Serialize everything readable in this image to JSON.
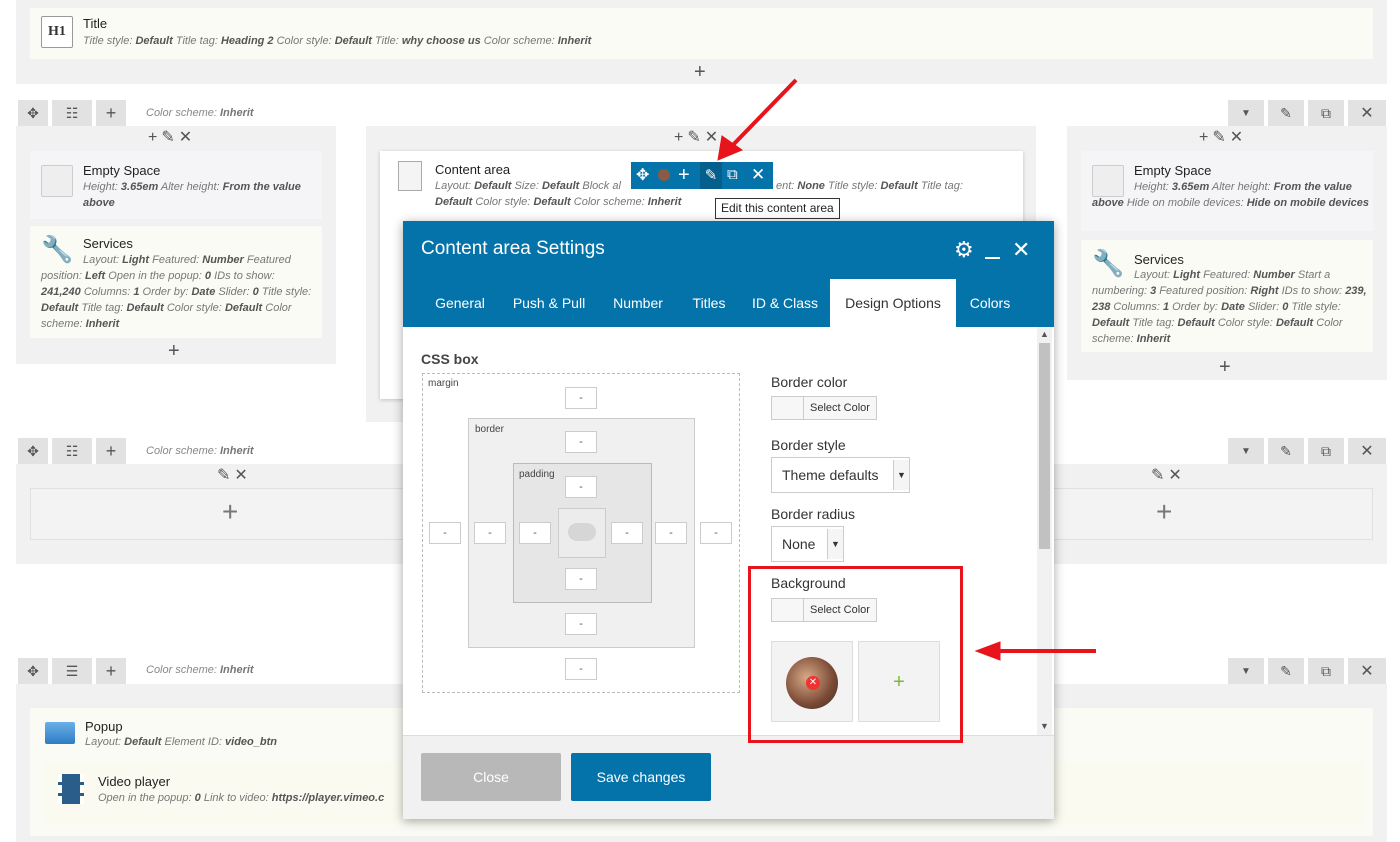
{
  "title_block": {
    "icon_text": "H1",
    "label": "Title",
    "meta": [
      {
        "k": "Title style:",
        "v": "Default"
      },
      {
        "k": "Title tag:",
        "v": "Heading 2"
      },
      {
        "k": "Color style:",
        "v": "Default"
      },
      {
        "k": "Title:",
        "v": "why choose us"
      },
      {
        "k": "Color scheme:",
        "v": "Inherit"
      }
    ],
    "add": "+"
  },
  "rows": {
    "color_scheme_label": "Color scheme:",
    "color_scheme_value": "Inherit"
  },
  "left_column": {
    "empty_space": {
      "label": "Empty Space",
      "meta": [
        {
          "k": "Height:",
          "v": "3.65em"
        },
        {
          "k": "Alter height:",
          "v": "From the value above"
        }
      ]
    },
    "services": {
      "label": "Services",
      "meta": [
        {
          "k": "Layout:",
          "v": "Light"
        },
        {
          "k": "Featured:",
          "v": "Number"
        },
        {
          "k": "Featured position:",
          "v": "Left"
        },
        {
          "k": "Open in the popup:",
          "v": "0"
        },
        {
          "k": "IDs to show:",
          "v": "241,240"
        },
        {
          "k": "Columns:",
          "v": "1"
        },
        {
          "k": "Order by:",
          "v": "Date"
        },
        {
          "k": "Slider:",
          "v": "0"
        },
        {
          "k": "Title style:",
          "v": "Default"
        },
        {
          "k": "Title tag:",
          "v": "Default"
        },
        {
          "k": "Color style:",
          "v": "Default"
        },
        {
          "k": "Color scheme:",
          "v": "Inherit"
        }
      ]
    }
  },
  "middle_column": {
    "content_area": {
      "label": "Content area",
      "meta_line1": [
        {
          "k": "Layout:",
          "v": "Default"
        },
        {
          "k": "Size:",
          "v": "Default"
        },
        {
          "k": "Block al",
          "v": ""
        }
      ],
      "meta_line1_tail": [
        {
          "k": "ent:",
          "v": "None"
        },
        {
          "k": "Title style:",
          "v": "Default"
        },
        {
          "k": "Title tag:",
          "v": ""
        }
      ],
      "meta_line2": [
        {
          "k": "",
          "v": "Default"
        },
        {
          "k": "Color style:",
          "v": "Default"
        },
        {
          "k": "Color scheme:",
          "v": "Inherit"
        }
      ]
    },
    "tooltip": "Edit this content area"
  },
  "right_column": {
    "empty_space": {
      "label": "Empty Space",
      "meta": [
        {
          "k": "Height:",
          "v": "3.65em"
        },
        {
          "k": "Alter height:",
          "v": "From the value above"
        },
        {
          "k": "Hide on mobile devices:",
          "v": "Hide on mobile devices"
        }
      ]
    },
    "services": {
      "label": "Services",
      "meta": [
        {
          "k": "Layout:",
          "v": "Light"
        },
        {
          "k": "Featured:",
          "v": "Number"
        },
        {
          "k": "Start a numbering:",
          "v": "3"
        },
        {
          "k": "Featured position:",
          "v": "Right"
        },
        {
          "k": "IDs to show:",
          "v": "239, 238"
        },
        {
          "k": "Columns:",
          "v": "1"
        },
        {
          "k": "Order by:",
          "v": "Date"
        },
        {
          "k": "Slider:",
          "v": "0"
        },
        {
          "k": "Title style:",
          "v": "Default"
        },
        {
          "k": "Title tag:",
          "v": "Default"
        },
        {
          "k": "Color style:",
          "v": "Default"
        },
        {
          "k": "Color scheme:",
          "v": "Inherit"
        }
      ]
    }
  },
  "bottom": {
    "popup": {
      "label": "Popup",
      "meta": [
        {
          "k": "Layout:",
          "v": "Default"
        },
        {
          "k": "Element ID:",
          "v": "video_btn"
        }
      ]
    },
    "video": {
      "label": "Video player",
      "meta": [
        {
          "k": "Open in the popup:",
          "v": "0"
        },
        {
          "k": "Link to video:",
          "v": "https://player.vimeo.c"
        }
      ]
    }
  },
  "modal": {
    "title": "Content area Settings",
    "tabs": [
      "General",
      "Push & Pull",
      "Number",
      "Titles",
      "ID & Class",
      "Design Options",
      "Colors"
    ],
    "active_tab": "Design Options",
    "css_box_label": "CSS box",
    "margin_label": "margin",
    "border_label": "border",
    "padding_label": "padding",
    "dash": "-",
    "border_color_label": "Border color",
    "select_color": "Select Color",
    "border_style_label": "Border style",
    "border_style_value": "Theme defaults",
    "border_radius_label": "Border radius",
    "border_radius_value": "None",
    "background_label": "Background",
    "add_image": "+",
    "close_label": "Close",
    "save_label": "Save changes"
  },
  "colors": {
    "modal_blue": "#0473aa",
    "annotation_red": "#e8141c"
  }
}
